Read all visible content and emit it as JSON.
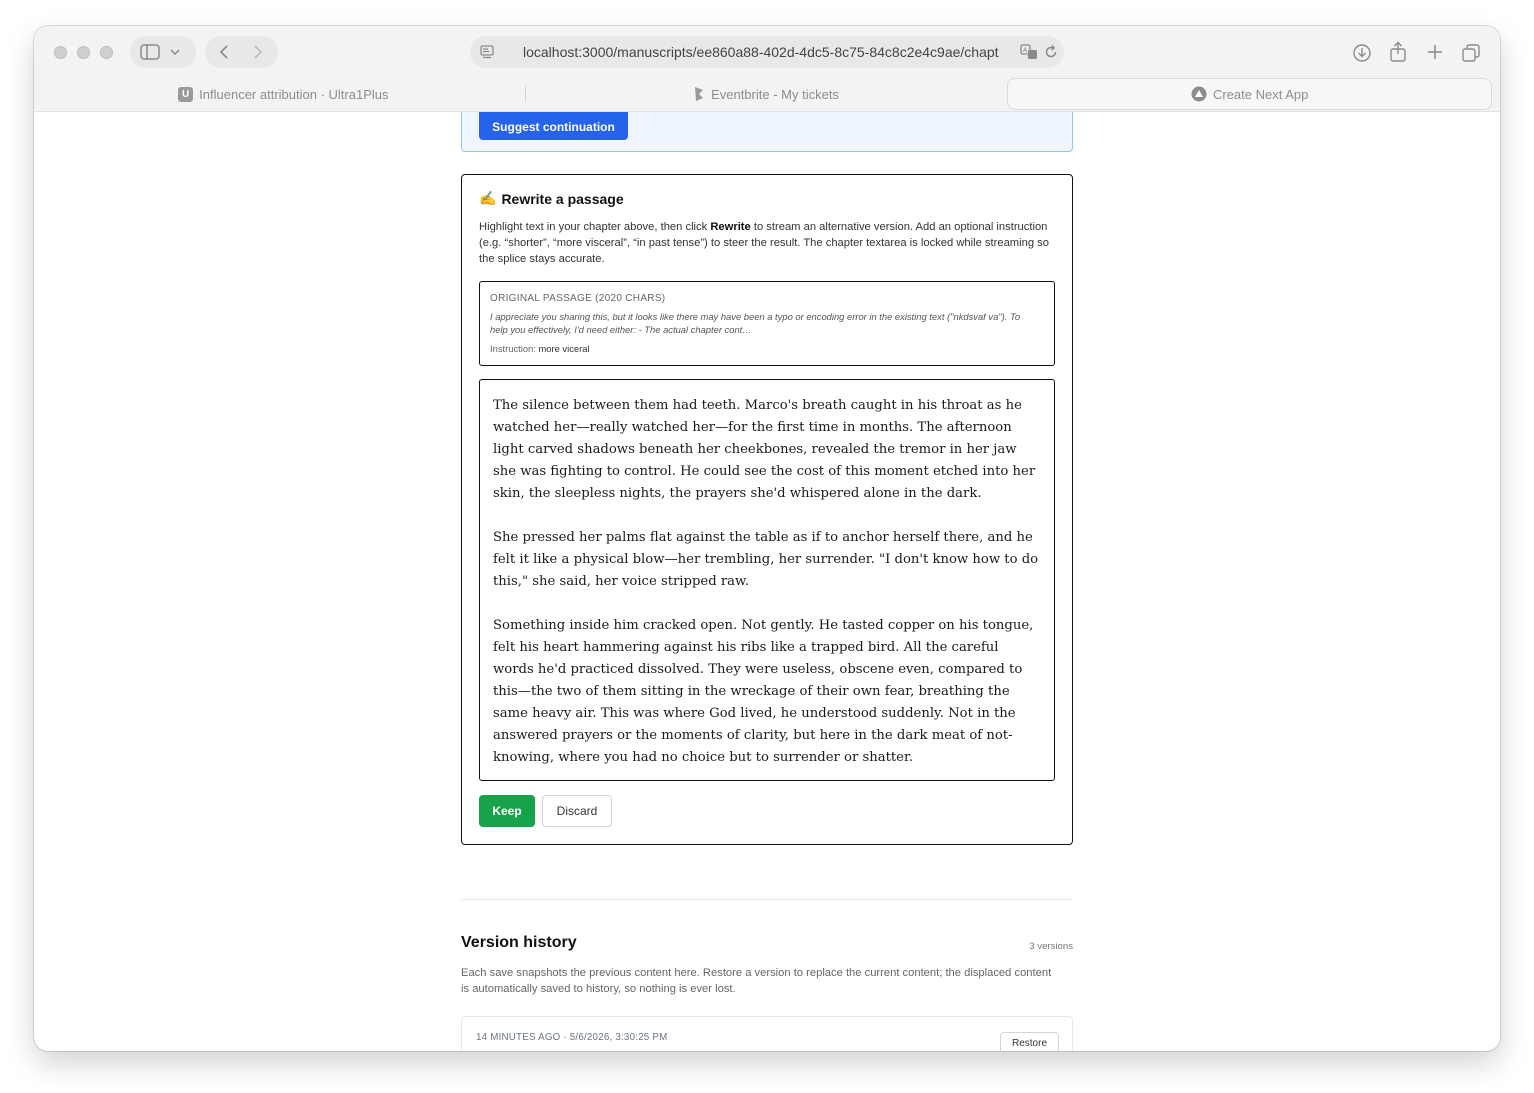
{
  "browser": {
    "url": "localhost:3000/manuscripts/ee860a88-402d-4dc5-8c75-84c8c2e4c9ae/chapt",
    "tabs": [
      {
        "label": "Influencer attribution · Ultra1Plus",
        "favicon": "U"
      },
      {
        "label": "Eventbrite - My tickets"
      },
      {
        "label": "Create Next App"
      }
    ]
  },
  "suggest": {
    "button_label": "Suggest continuation"
  },
  "rewrite": {
    "emoji": "✍️",
    "title": "Rewrite a passage",
    "desc_before": "Highlight text in your chapter above, then click ",
    "desc_bold": "Rewrite",
    "desc_after": " to stream an alternative version. Add an optional instruction (e.g. “shorter”, “more visceral”, “in past tense”) to steer the result. The chapter textarea is locked while streaming so the splice stays accurate.",
    "original": {
      "label": "ORIGINAL PASSAGE (2020 CHARS)",
      "text": "I appreciate you sharing this, but it looks like there may have been a typo or encoding error in the existing text (\"nkdsvaf va\"). To help you effectively, I'd need either: - The actual chapter cont…",
      "instruction_label": "Instruction:",
      "instruction_value": "more viceral"
    },
    "result_paragraphs": [
      "The silence between them had teeth. Marco's breath caught in his throat as he watched her—really watched her—for the first time in months. The afternoon light carved shadows beneath her cheekbones, revealed the tremor in her jaw she was fighting to control. He could see the cost of this moment etched into her skin, the sleepless nights, the prayers she'd whispered alone in the dark.",
      "She pressed her palms flat against the table as if to anchor herself there, and he felt it like a physical blow—her trembling, her surrender. \"I don't know how to do this,\" she said, her voice stripped raw.",
      "Something inside him cracked open. Not gently. He tasted copper on his tongue, felt his heart hammering against his ribs like a trapped bird. All the careful words he'd practiced dissolved. They were useless, obscene even, compared to this—the two of them sitting in the wreckage of their own fear, breathing the same heavy air. This was where God lived, he understood suddenly. Not in the answered prayers or the moments of clarity, but here in the dark meat of not-knowing, where you had no choice but to surrender or shatter."
    ],
    "keep_label": "Keep",
    "discard_label": "Discard"
  },
  "version_history": {
    "title": "Version history",
    "count": "3 versions",
    "description": "Each save snapshots the previous content here. Restore a version to replace the current content; the displaced content is automatically saved to history, so nothing is ever lost.",
    "versions": [
      {
        "meta": "14 MINUTES AGO · 5/6/2026, 3:30:25 PM",
        "restore_label": "Restore"
      }
    ]
  },
  "dev_badge": "N",
  "colors": {
    "primary_blue": "#2563eb",
    "keep_green": "#16a34a",
    "suggest_bg": "#eff6ff"
  }
}
